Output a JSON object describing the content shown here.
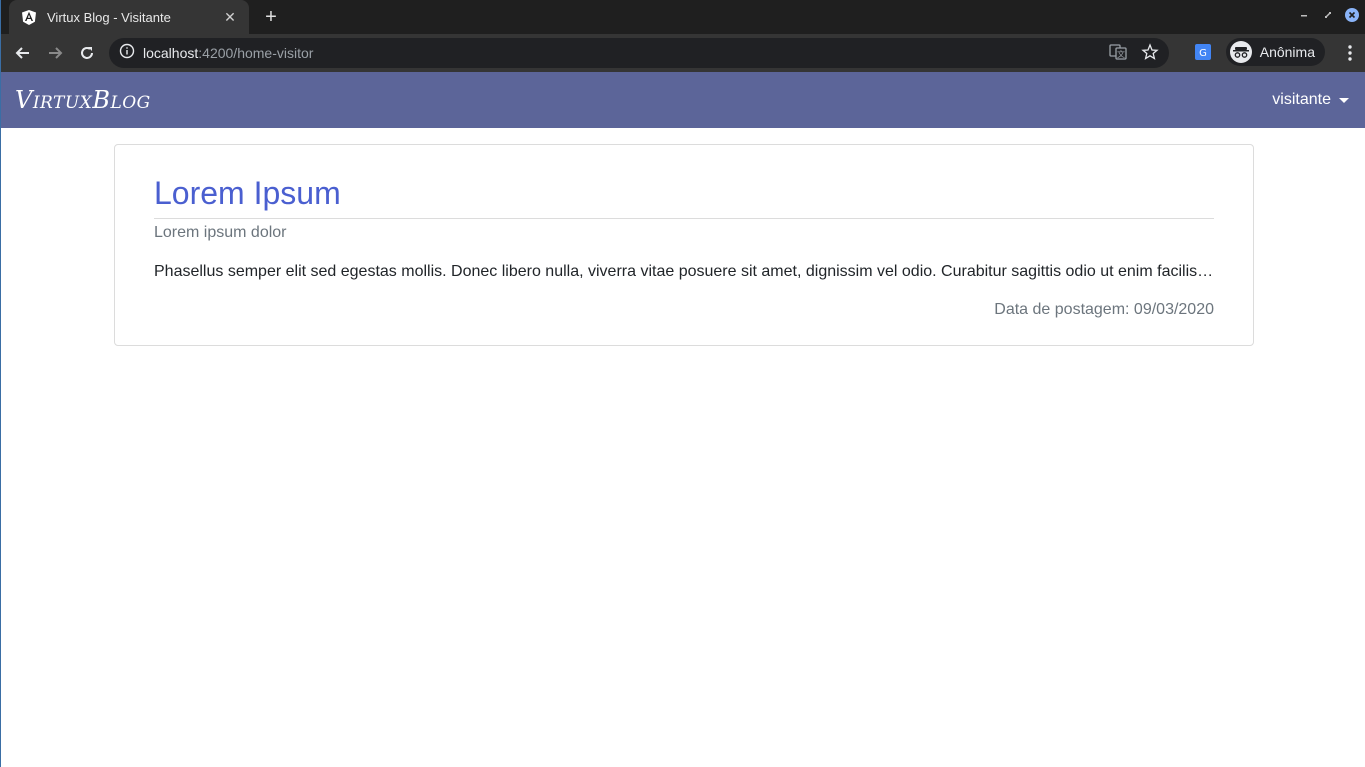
{
  "browser": {
    "tab_title": "Virtux Blog - Visitante",
    "url_host": "localhost",
    "url_rest": ":4200/home-visitor",
    "profile_label": "Anônima"
  },
  "navbar": {
    "brand": "VirtuxBlog",
    "user_menu_label": "visitante",
    "bg_color": "#5c6599"
  },
  "posts": [
    {
      "title": "Lorem Ipsum",
      "subtitle": "Lorem ipsum dolor",
      "excerpt": "Phasellus semper elit sed egestas mollis. Donec libero nulla, viverra vitae posuere sit amet, dignissim vel odio. Curabitur sagittis odio ut enim facilisis ornare.",
      "date_text": "Data de postagem: 09/03/2020"
    }
  ],
  "colors": {
    "title": "#4a5fd0",
    "muted": "#6c757d"
  }
}
